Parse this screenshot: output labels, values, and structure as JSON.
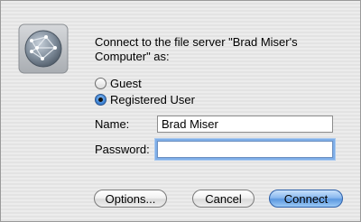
{
  "dialog": {
    "message": "Connect to the file server \"Brad Miser's Computer\" as:",
    "icon": "server-globe-icon"
  },
  "connect_as": {
    "options": [
      {
        "label": "Guest",
        "selected": false
      },
      {
        "label": "Registered User",
        "selected": true
      }
    ]
  },
  "fields": {
    "name_label": "Name:",
    "name_value": "Brad Miser",
    "password_label": "Password:",
    "password_value": ""
  },
  "buttons": {
    "options_label": "Options...",
    "cancel_label": "Cancel",
    "connect_label": "Connect"
  },
  "colors": {
    "accent": "#5c98e0"
  }
}
